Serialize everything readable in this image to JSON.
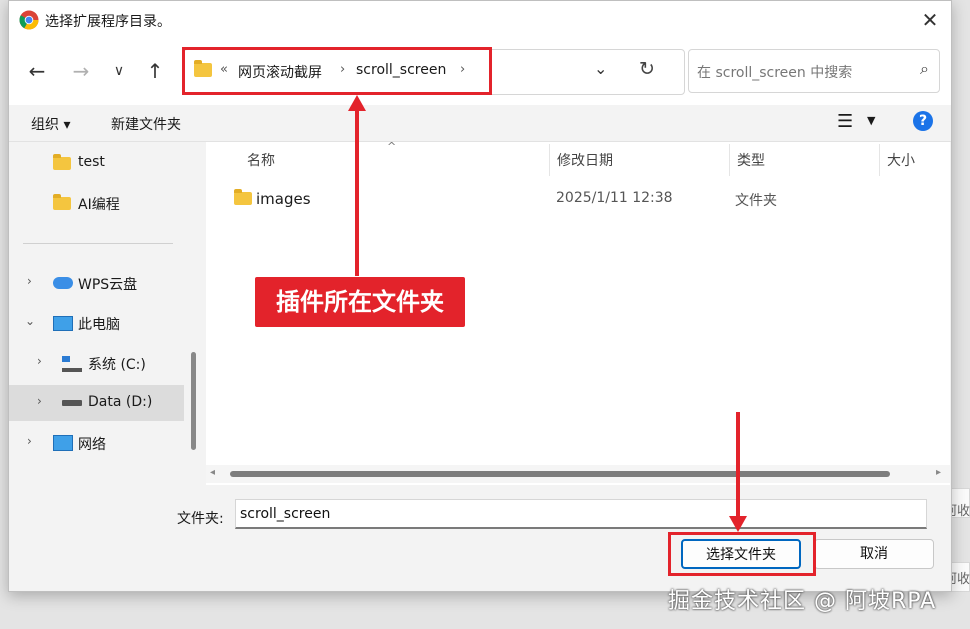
{
  "window": {
    "title": "选择扩展程序目录。"
  },
  "background_texts": [
    "阿收",
    "阿收"
  ],
  "address": {
    "overflow": "«",
    "crumbs": [
      "网页滚动截屏",
      "scroll_screen"
    ],
    "sep": "›"
  },
  "search": {
    "placeholder": "在 scroll_screen 中搜索"
  },
  "toolbar": {
    "organize": "组织 ▾",
    "new_folder": "新建文件夹",
    "help": "?"
  },
  "nav": {
    "items": [
      {
        "label": "test"
      },
      {
        "label": "AI编程"
      },
      {
        "label": "WPS云盘"
      },
      {
        "label": "此电脑"
      },
      {
        "label": "系统 (C:)"
      },
      {
        "label": "Data (D:)"
      },
      {
        "label": "网络"
      }
    ]
  },
  "columns": {
    "name": "名称",
    "modified": "修改日期",
    "type": "类型",
    "size": "大小"
  },
  "files": [
    {
      "name": "images",
      "modified": "2025/1/11 12:38",
      "type": "文件夹"
    }
  ],
  "bottom": {
    "folder_label": "文件夹:",
    "folder_value": "scroll_screen",
    "select_button": "选择文件夹",
    "cancel_button": "取消"
  },
  "annotation": {
    "callout": "插件所在文件夹",
    "color": "#e3232b"
  },
  "watermark": "掘金技术社区 @ 阿坡RPA"
}
